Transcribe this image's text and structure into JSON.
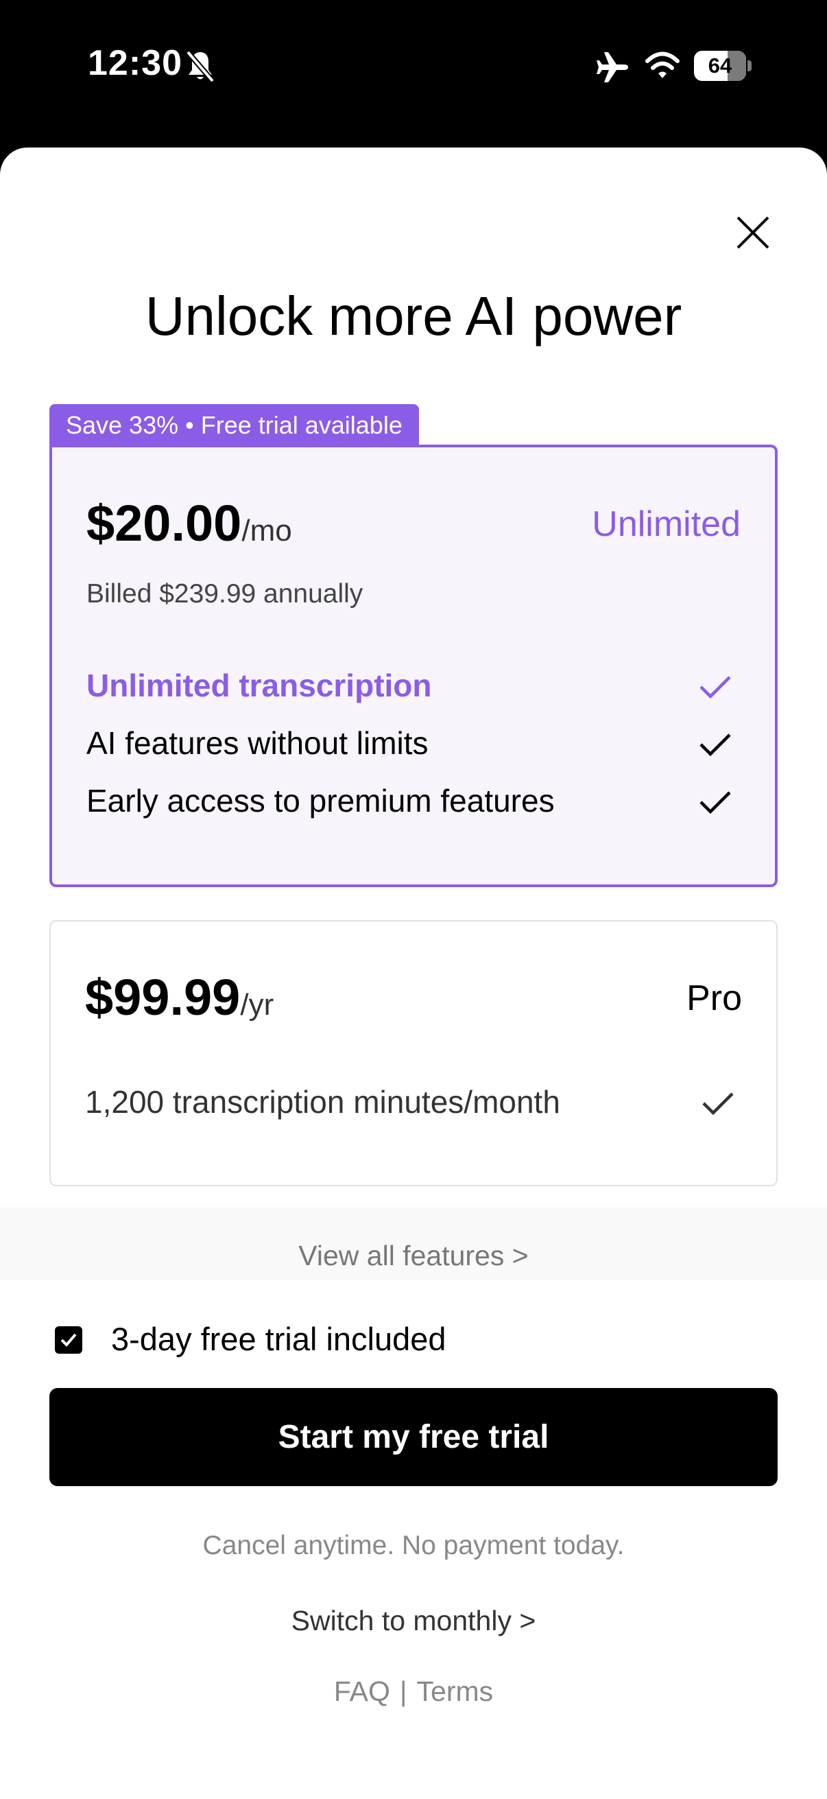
{
  "status_bar": {
    "time": "12:30",
    "battery": "64",
    "battery_level": 0.64
  },
  "sheet": {
    "headline": "Unlock more AI power",
    "plans": [
      {
        "badge": "Save 33% • Free trial available",
        "price": "$20.00",
        "period": "/mo",
        "name": "Unlimited",
        "billed": "Billed $239.99 annually",
        "features": [
          "Unlimited transcription",
          "AI features without limits",
          "Early access to premium features"
        ]
      },
      {
        "price": "$99.99",
        "period": "/yr",
        "name": "Pro",
        "features": [
          "1,200 transcription minutes/month"
        ]
      }
    ],
    "view_all": "View all features >"
  },
  "bottom": {
    "trial_label": "3-day free trial included",
    "trial_checked": true,
    "cta": "Start my free trial",
    "fine_print": "Cancel anytime. No payment today.",
    "switch": "Switch to monthly >",
    "faq": "FAQ",
    "separator": "|",
    "terms": "Terms"
  },
  "colors": {
    "accent": "#8b5ce6",
    "card_tint": "#f7f4fb",
    "cta": "#000000"
  },
  "icons": [
    "bell-slash-icon",
    "airplane-icon",
    "wifi-icon",
    "battery-icon",
    "close-icon",
    "check-icon",
    "checkbox-check-icon"
  ]
}
